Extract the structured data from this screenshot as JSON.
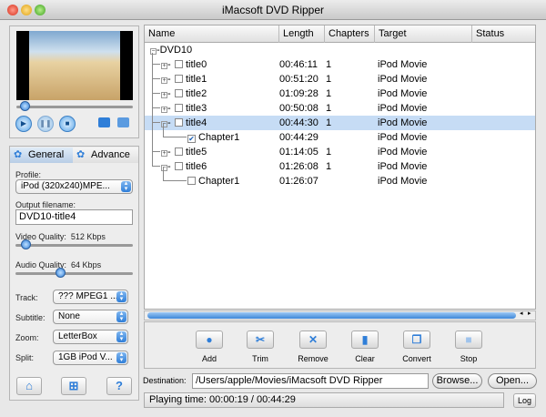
{
  "window": {
    "title": "iMacsoft DVD Ripper"
  },
  "preview": {
    "playback_fraction": 0.03
  },
  "tabs": {
    "general": "General",
    "advance": "Advance"
  },
  "settings": {
    "profile_label": "Profile:",
    "profile_value": "iPod (320x240)MPE...",
    "output_label": "Output filename:",
    "output_value": "DVD10-title4",
    "video_quality_label": "Video Quality:",
    "video_quality_value": "512 Kbps",
    "video_quality_fraction": 0.05,
    "audio_quality_label": "Audio Quality:",
    "audio_quality_value": "64 Kbps",
    "audio_quality_fraction": 0.37,
    "track_label": "Track:",
    "track_value": "??? MPEG1 ...",
    "subtitle_label": "Subtitle:",
    "subtitle_value": "None",
    "zoom_label": "Zoom:",
    "zoom_value": "LetterBox",
    "split_label": "Split:",
    "split_value": "1GB iPod V..."
  },
  "table": {
    "columns": [
      "Name",
      "Length",
      "Chapters",
      "Target",
      "Status"
    ],
    "root": "DVD10",
    "rows": [
      {
        "name": "title0",
        "length": "00:46:11",
        "chapters": "1",
        "target": "iPod Movie"
      },
      {
        "name": "title1",
        "length": "00:51:20",
        "chapters": "1",
        "target": "iPod Movie"
      },
      {
        "name": "title2",
        "length": "01:09:28",
        "chapters": "1",
        "target": "iPod Movie"
      },
      {
        "name": "title3",
        "length": "00:50:08",
        "chapters": "1",
        "target": "iPod Movie"
      },
      {
        "name": "title4",
        "length": "00:44:30",
        "chapters": "1",
        "target": "iPod Movie"
      },
      {
        "name": "Chapter1",
        "length": "00:44:29",
        "chapters": "",
        "target": "iPod Movie"
      },
      {
        "name": "title5",
        "length": "01:14:05",
        "chapters": "1",
        "target": "iPod Movie"
      },
      {
        "name": "title6",
        "length": "01:26:08",
        "chapters": "1",
        "target": "iPod Movie"
      },
      {
        "name": "Chapter1",
        "length": "01:26:07",
        "chapters": "",
        "target": "iPod Movie"
      }
    ]
  },
  "toolbar": {
    "add": "Add",
    "trim": "Trim",
    "remove": "Remove",
    "clear": "Clear",
    "convert": "Convert",
    "stop": "Stop"
  },
  "destination": {
    "label": "Destination:",
    "value": "/Users/apple/Movies/iMacsoft DVD Ripper",
    "browse": "Browse...",
    "open": "Open..."
  },
  "status": {
    "text": "Playing time: 00:00:19 / 00:44:29",
    "log": "Log"
  }
}
